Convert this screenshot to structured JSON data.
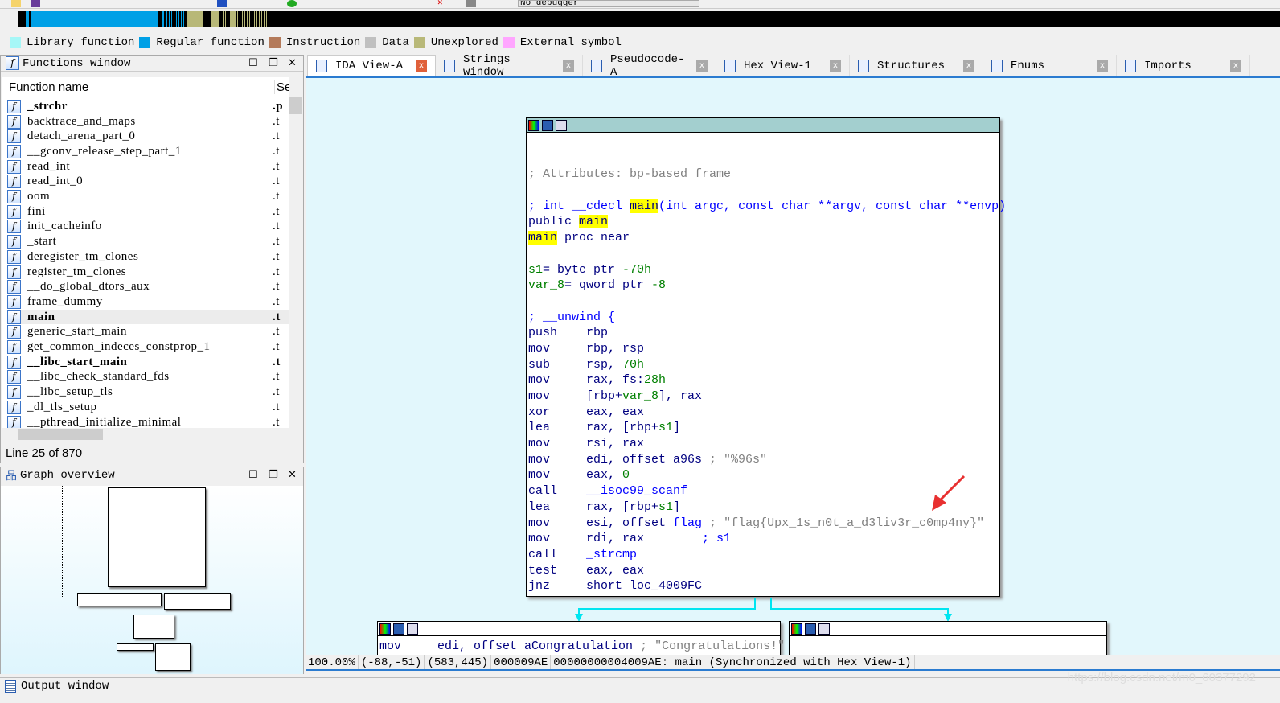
{
  "toolbar": {
    "debugger_select": "No debugger"
  },
  "colors": {
    "library_function": "#a6f7f7",
    "regular_function": "#00a0e6",
    "instruction": "#b47a5a",
    "data": "#c0c0c0",
    "unexplored": "#b8b878",
    "external_symbol": "#ffa6ff",
    "block_header": "#a3cfcf",
    "highlight": "#ffff00"
  },
  "legend": [
    "Library function",
    "Regular function",
    "Instruction",
    "Data",
    "Unexplored",
    "External symbol"
  ],
  "functions_window": {
    "title": "Functions window",
    "col_name": "Function name",
    "col_segment": "Se",
    "rows": [
      {
        "name": "_strchr",
        "seg": ".p",
        "bold": true
      },
      {
        "name": "backtrace_and_maps",
        "seg": ".t"
      },
      {
        "name": "detach_arena_part_0",
        "seg": ".t"
      },
      {
        "name": "__gconv_release_step_part_1",
        "seg": ".t"
      },
      {
        "name": "read_int",
        "seg": ".t"
      },
      {
        "name": "read_int_0",
        "seg": ".t"
      },
      {
        "name": "oom",
        "seg": ".t"
      },
      {
        "name": "fini",
        "seg": ".t"
      },
      {
        "name": "init_cacheinfo",
        "seg": ".t"
      },
      {
        "name": "_start",
        "seg": ".t"
      },
      {
        "name": "deregister_tm_clones",
        "seg": ".t"
      },
      {
        "name": "register_tm_clones",
        "seg": ".t"
      },
      {
        "name": "__do_global_dtors_aux",
        "seg": ".t"
      },
      {
        "name": "frame_dummy",
        "seg": ".t"
      },
      {
        "name": "main",
        "seg": ".t",
        "bold": true,
        "selected": true
      },
      {
        "name": "generic_start_main",
        "seg": ".t"
      },
      {
        "name": "get_common_indeces_constprop_1",
        "seg": ".t"
      },
      {
        "name": "__libc_start_main",
        "seg": ".t",
        "bold": true
      },
      {
        "name": "__libc_check_standard_fds",
        "seg": ".t"
      },
      {
        "name": "__libc_setup_tls",
        "seg": ".t"
      },
      {
        "name": "_dl_tls_setup",
        "seg": ".t"
      },
      {
        "name": "__pthread_initialize_minimal",
        "seg": ".t"
      }
    ],
    "line_status": "Line 25 of 870"
  },
  "graph_overview": {
    "title": "Graph overview"
  },
  "output_window": {
    "title": "Output window"
  },
  "tabs": [
    {
      "label": "IDA View-A",
      "active": true
    },
    {
      "label": "Strings window"
    },
    {
      "label": "Pseudocode-A"
    },
    {
      "label": "Hex View-1"
    },
    {
      "label": "Structures"
    },
    {
      "label": "Enums"
    },
    {
      "label": "Imports"
    }
  ],
  "main_block": {
    "lines": [
      [],
      [],
      [
        [
          "; Attributes: bp-based frame",
          "cm"
        ]
      ],
      [],
      [
        [
          "; int __cdecl ",
          "cb"
        ],
        [
          "main",
          "hl"
        ],
        [
          "(int argc, const char **argv, const char **envp)",
          "cb"
        ]
      ],
      [
        [
          "public ",
          "op"
        ],
        [
          "main",
          "hl"
        ]
      ],
      [
        [
          "main",
          "hl"
        ],
        [
          " proc near",
          "op"
        ]
      ],
      [],
      [
        [
          "s1",
          "nu"
        ],
        [
          "= byte ptr ",
          "op"
        ],
        [
          "-70h",
          "nu"
        ]
      ],
      [
        [
          "var_8",
          "nu"
        ],
        [
          "= qword ptr ",
          "op"
        ],
        [
          "-8",
          "nu"
        ]
      ],
      [],
      [
        [
          "; __unwind {",
          "cb"
        ]
      ],
      [
        [
          "push    ",
          "mn"
        ],
        [
          "rbp",
          "op"
        ]
      ],
      [
        [
          "mov     ",
          "mn"
        ],
        [
          "rbp, rsp",
          "op"
        ]
      ],
      [
        [
          "sub     ",
          "mn"
        ],
        [
          "rsp, ",
          "op"
        ],
        [
          "70h",
          "nu"
        ]
      ],
      [
        [
          "mov     ",
          "mn"
        ],
        [
          "rax, fs:",
          "op"
        ],
        [
          "28h",
          "nu"
        ]
      ],
      [
        [
          "mov     ",
          "mn"
        ],
        [
          "[rbp+",
          "op"
        ],
        [
          "var_8",
          "nu"
        ],
        [
          "], rax",
          "op"
        ]
      ],
      [
        [
          "xor     ",
          "mn"
        ],
        [
          "eax, eax",
          "op"
        ]
      ],
      [
        [
          "lea     ",
          "mn"
        ],
        [
          "rax, [rbp+",
          "op"
        ],
        [
          "s1",
          "nu"
        ],
        [
          "]",
          "op"
        ]
      ],
      [
        [
          "mov     ",
          "mn"
        ],
        [
          "rsi, rax",
          "op"
        ]
      ],
      [
        [
          "mov     ",
          "mn"
        ],
        [
          "edi, offset a96s ",
          "op"
        ],
        [
          "; \"%96s\"",
          "cm"
        ]
      ],
      [
        [
          "mov     ",
          "mn"
        ],
        [
          "eax, ",
          "op"
        ],
        [
          "0",
          "nu"
        ]
      ],
      [
        [
          "call    ",
          "mn"
        ],
        [
          "__isoc99_scanf",
          "fn"
        ]
      ],
      [
        [
          "lea     ",
          "mn"
        ],
        [
          "rax, [rbp+",
          "op"
        ],
        [
          "s1",
          "nu"
        ],
        [
          "]",
          "op"
        ]
      ],
      [
        [
          "mov     ",
          "mn"
        ],
        [
          "esi, offset ",
          "op"
        ],
        [
          "flag",
          "fn"
        ],
        [
          " ; \"flag{Upx_1s_n0t_a_d3liv3r_c0mp4ny}\"",
          "cm"
        ]
      ],
      [
        [
          "mov     ",
          "mn"
        ],
        [
          "rdi, rax        ",
          "op"
        ],
        [
          "; s1",
          "cb"
        ]
      ],
      [
        [
          "call    ",
          "mn"
        ],
        [
          "_strcmp",
          "fn"
        ]
      ],
      [
        [
          "test    ",
          "mn"
        ],
        [
          "eax, eax",
          "op"
        ]
      ],
      [
        [
          "jnz     ",
          "mn"
        ],
        [
          "short loc_4009FC",
          "op"
        ]
      ]
    ]
  },
  "left_block": {
    "lines": [
      [
        [
          "mov     ",
          "mn"
        ],
        [
          "edi, offset aCongratulation ",
          "op"
        ],
        [
          "; \"Congratulations!\"",
          "cm"
        ]
      ]
    ]
  },
  "status_bar": [
    "100.00%",
    "(-88,-51)",
    "(583,445)",
    "000009AE",
    "00000000004009AE: main (Synchronized with Hex View-1)"
  ],
  "watermark": "https://blog.csdn.net/m0_60377292"
}
